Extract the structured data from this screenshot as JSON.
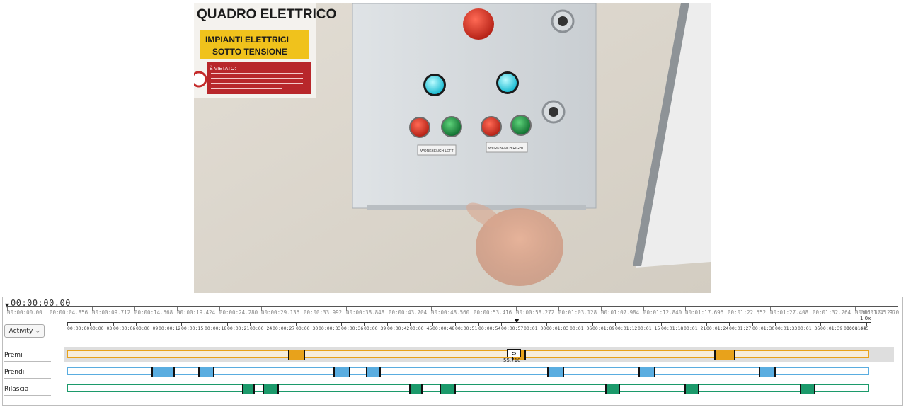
{
  "video": {
    "sign_title": "QUADRO ELETTRICO",
    "sign_warning_line1": "IMPIANTI ELETTRICI",
    "sign_warning_line2": "SOTTO TENSIONE",
    "sign_forbidden": "È VIETATO:",
    "label_left": "WORKBENCH LEFT",
    "label_right": "WORKBENCH RIGHT"
  },
  "timeline": {
    "timecode": "00:00:00.00",
    "zoom": "1.0x",
    "playhead_time": "55.710",
    "top_ticks": [
      "00:00:00.00",
      "00:00:04.856",
      "00:00:09.712",
      "00:00:14.568",
      "00:00:19.424",
      "00:00:24.280",
      "00:00:29.136",
      "00:00:33.992",
      "00:00:38.848",
      "00:00:43.704",
      "00:00:48.560",
      "00:00:53.416",
      "00:00:58.272",
      "00:01:03.128",
      "00:01:07.984",
      "00:01:12.840",
      "00:01:17.696",
      "00:01:22.552",
      "00:01:27.408",
      "00:01:32.264",
      "00:01:37.121",
      "00:01:45.970"
    ],
    "sub_ticks": [
      "00:00:00",
      "00:00:03",
      "00:00:06",
      "00:00:09",
      "00:00:12",
      "00:00:15",
      "00:00:18",
      "00:00:21",
      "00:00:24",
      "00:00:27",
      "00:00:30",
      "00:00:33",
      "00:00:36",
      "00:00:39",
      "00:00:42",
      "00:00:45",
      "00:00:48",
      "00:00:51",
      "00:00:54",
      "00:00:57",
      "00:01:00",
      "00:01:03",
      "00:01:06",
      "00:01:09",
      "00:01:12",
      "00:01:15",
      "00:01:18",
      "00:01:21",
      "00:01:24",
      "00:01:27",
      "00:01:30",
      "00:01:33",
      "00:01:36",
      "00:01:39",
      "00:01:42",
      "00:01:45"
    ]
  },
  "activity_button": {
    "label": "Activity",
    "icon": "chevron-down-icon"
  },
  "tracks": [
    {
      "label": "Premi",
      "color": "#e8a21b",
      "segments_sec": [
        [
          29.1,
          31.3
        ],
        [
          58.6,
          60.5
        ],
        [
          85.4,
          88.2
        ]
      ]
    },
    {
      "label": "Prendi",
      "color": "#5aade0",
      "segments_sec": [
        [
          11.0,
          14.1
        ],
        [
          17.2,
          19.4
        ],
        [
          35.1,
          37.3
        ],
        [
          39.4,
          41.3
        ],
        [
          63.3,
          65.6
        ],
        [
          75.4,
          77.6
        ],
        [
          91.3,
          93.5
        ]
      ]
    },
    {
      "label": "Rilascia",
      "color": "#1c9a6b",
      "segments_sec": [
        [
          23.0,
          24.7
        ],
        [
          25.7,
          27.9
        ],
        [
          45.1,
          46.9
        ],
        [
          49.1,
          51.3
        ],
        [
          71.0,
          73.0
        ],
        [
          81.5,
          83.4
        ],
        [
          96.7,
          98.8
        ]
      ]
    }
  ],
  "timeline_duration_sec": 105.97
}
